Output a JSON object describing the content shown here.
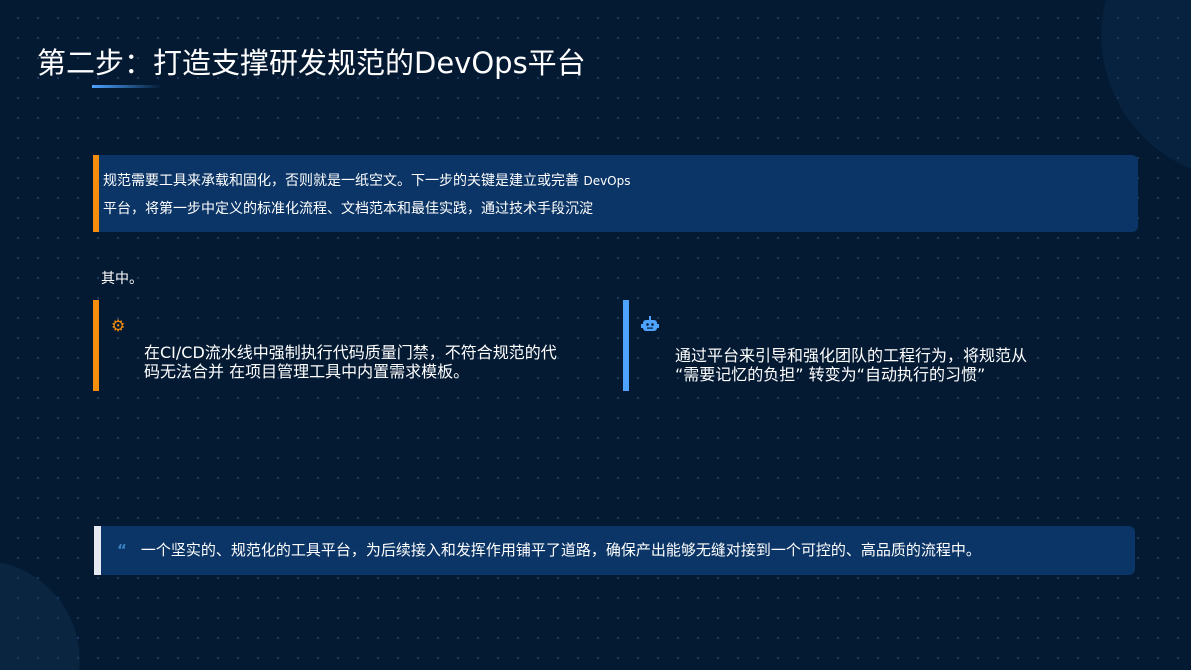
{
  "title": "第二步：打造支撑研发规范的DevOps平台",
  "intro": {
    "line1": "规范需要工具来承载和固化，否则就是一纸空文。下一步的关键是建立或完善",
    "line1_tag": "DevOps",
    "line2": "平台，将第一步中定义的标准化流程、文档范本和最佳实践，通过技术手段沉淀"
  },
  "note": "其中。",
  "cards": [
    {
      "icon": "gears-icon",
      "line1": "在CI/CD流水线中强制执行代码质量门禁，不符合规范的代",
      "line2": "码无法合并 在项目管理工具中内置需求模板。"
    },
    {
      "icon": "robot-icon",
      "line1": "通过平台来引导和强化团队的工程行为，将规范从",
      "line2": "“需要记忆的负担”  转变为“自动执行的习惯”"
    }
  ],
  "quote": {
    "mark": "“",
    "text": "一个坚实的、规范化的工具平台，为后续接入和发挥作用铺平了道路，确保产出能够无缝对接到一个可控的、高品质的流程中。"
  },
  "colors": {
    "orange": "#f68d0d",
    "blue": "#4da3ff"
  }
}
